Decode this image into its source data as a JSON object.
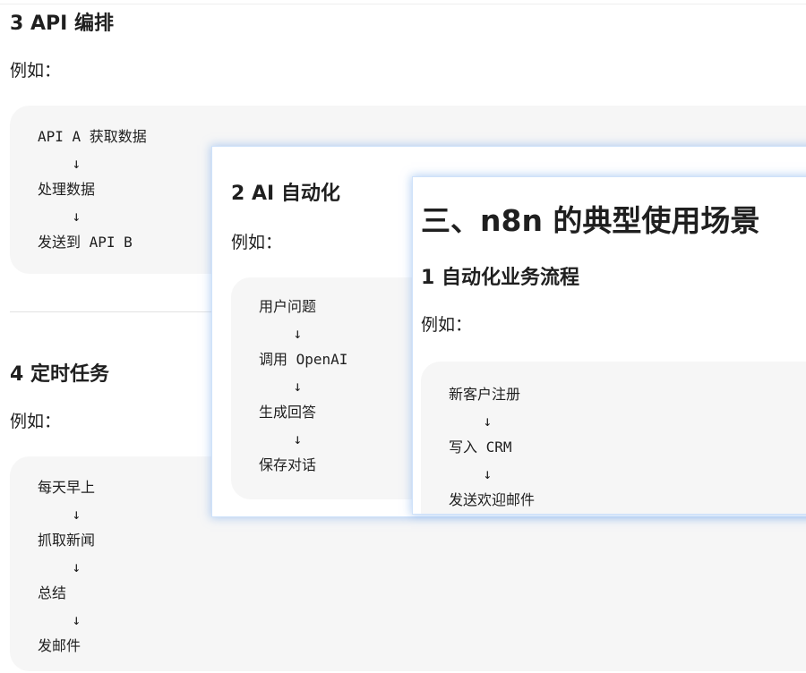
{
  "section3": {
    "heading": "3 API 编排",
    "intro": "例如：",
    "code": "API A 获取数据\n    ↓\n处理数据\n    ↓\n发送到 API B"
  },
  "section4": {
    "heading": "4 定时任务",
    "intro": "例如：",
    "code": "每天早上\n    ↓\n抓取新闻\n    ↓\n总结\n    ↓\n发邮件"
  },
  "window_ai": {
    "heading": "2 AI 自动化",
    "intro": "例如：",
    "code": "用户问题\n    ↓\n调用 OpenAI\n    ↓\n生成回答\n    ↓\n保存对话"
  },
  "window_main": {
    "title": "三、n8n 的典型使用场景",
    "heading": "1 自动化业务流程",
    "intro": "例如：",
    "code": "新客户注册\n    ↓\n写入 CRM\n    ↓\n发送欢迎邮件"
  }
}
